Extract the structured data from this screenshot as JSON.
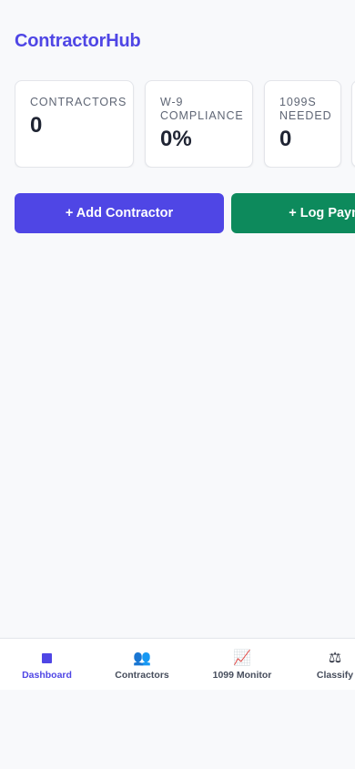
{
  "app": {
    "title": "ContractorHub"
  },
  "stats": [
    {
      "label_line1": "CONTRACTORS",
      "label_line2": "",
      "value": "0"
    },
    {
      "label_line1": "W-9",
      "label_line2": "COMPLIANCE",
      "value": "0%"
    },
    {
      "label_line1": "1099S",
      "label_line2": "NEEDED",
      "value": "0"
    }
  ],
  "actions": {
    "add_contractor": "+ Add Contractor",
    "log_payment": "+ Log Payment"
  },
  "tabs": [
    {
      "label": "Dashboard",
      "icon": "dashboard-square-icon",
      "glyph": "■"
    },
    {
      "label": "Contractors",
      "icon": "people-icon",
      "glyph": "👥"
    },
    {
      "label": "1099 Monitor",
      "icon": "chart-increasing-icon",
      "glyph": "📈"
    },
    {
      "label": "Classify",
      "icon": "balance-scale-icon",
      "glyph": "⚖"
    }
  ],
  "colors": {
    "brand": "#4f46e5",
    "success": "#0d8a5c",
    "background": "#f8f9fb"
  }
}
